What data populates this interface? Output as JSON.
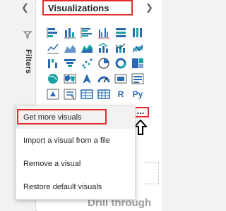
{
  "visualizations_pane": {
    "title": "Visualizations",
    "more_options": "...",
    "icons": [
      "stacked-bar-chart-icon",
      "stacked-column-chart-icon",
      "clustered-bar-chart-icon",
      "clustered-column-chart-icon",
      "100-stacked-bar-chart-icon",
      "100-stacked-column-chart-icon",
      "line-chart-icon",
      "area-chart-icon",
      "stacked-area-chart-icon",
      "line-clustered-column-icon",
      "line-stacked-column-icon",
      "ribbon-chart-icon",
      "waterfall-chart-icon",
      "funnel-chart-icon",
      "scatter-chart-icon",
      "pie-chart-icon",
      "donut-chart-icon",
      "treemap-icon",
      "map-icon",
      "filled-map-icon",
      "azure-map-icon",
      "gauge-icon",
      "card-icon",
      "multi-row-card-icon",
      "kpi-icon",
      "slicer-icon",
      "table-icon",
      "matrix-icon",
      "r-script-visual-icon",
      "python-visual-icon"
    ],
    "r_label": "R",
    "py_label": "Py"
  },
  "filters_pane": {
    "label": "Filters"
  },
  "context_menu": {
    "items": [
      {
        "label": "Get more visuals"
      },
      {
        "label": "Import a visual from a file"
      },
      {
        "label": "Remove a visual"
      },
      {
        "label": "Restore default visuals"
      }
    ]
  },
  "drill_through": {
    "label": "Drill through"
  },
  "colors": {
    "highlight_outline": "#e32b2b",
    "icon_blue": "#2a6ab0",
    "icon_teal": "#19a2a0"
  }
}
